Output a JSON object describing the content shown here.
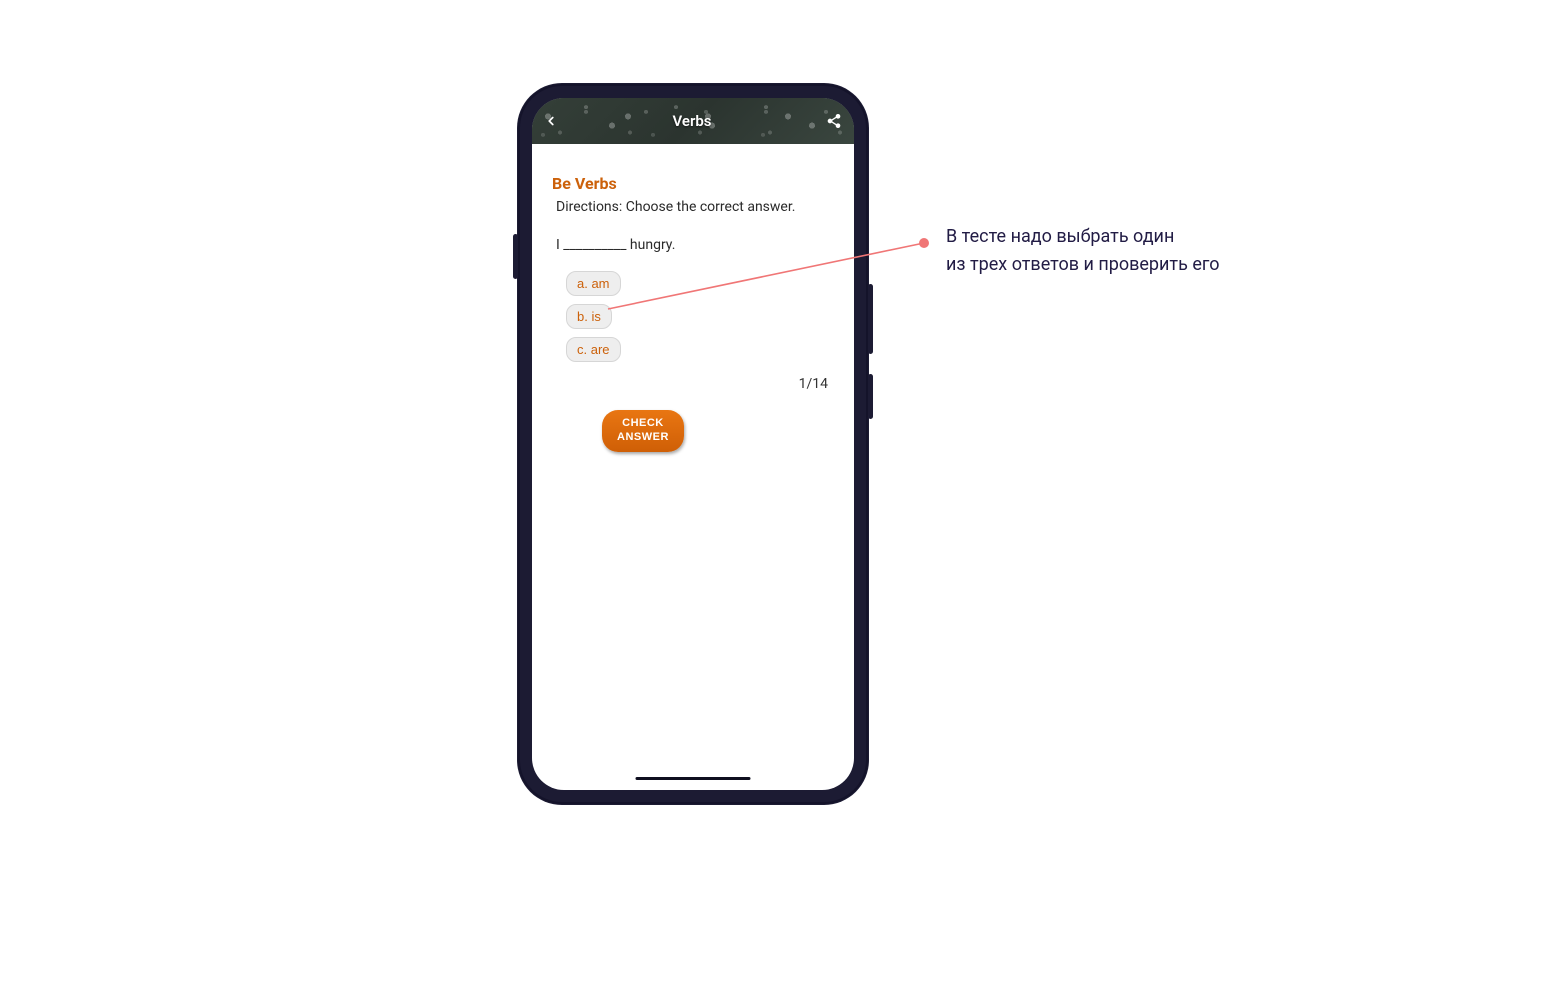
{
  "header": {
    "title": "Verbs"
  },
  "section": {
    "title": "Be Verbs",
    "directions": "Directions: Choose the correct answer.",
    "question": "I __________ hungry."
  },
  "options": [
    {
      "label": "a. am"
    },
    {
      "label": "b. is"
    },
    {
      "label": "c. are"
    }
  ],
  "progress": "1/14",
  "check_button": "CHECK\nANSWER",
  "annotation": {
    "line1": "В тесте надо выбрать один",
    "line2": "из трех ответов и проверить его"
  },
  "colors": {
    "accent": "#cc610a",
    "phone_frame": "#1c1b33",
    "annotation_text": "#221c45",
    "callout_line": "#f07676"
  }
}
